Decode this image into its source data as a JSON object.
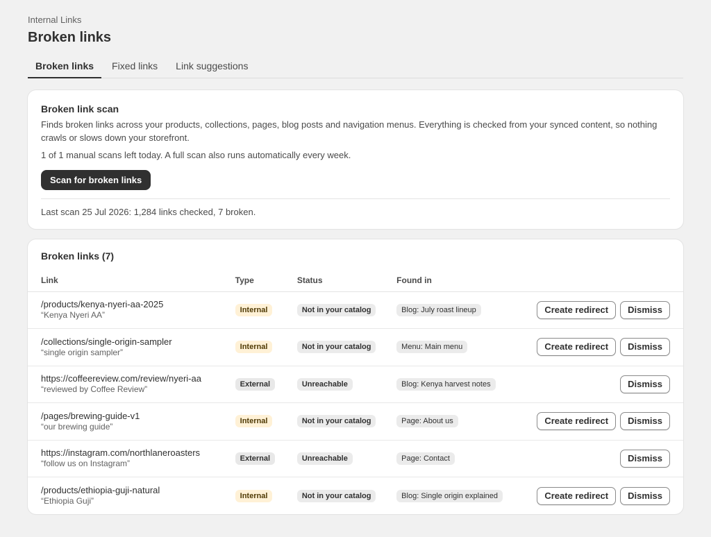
{
  "header": {
    "breadcrumb": "Internal Links",
    "title": "Broken links"
  },
  "tabs": [
    {
      "label": "Broken links",
      "active": true
    },
    {
      "label": "Fixed links",
      "active": false
    },
    {
      "label": "Link suggestions",
      "active": false
    }
  ],
  "scan": {
    "title": "Broken link scan",
    "description": "Finds broken links across your products, collections, pages, blog posts and navigation menus. Everything is checked from your synced content, so nothing crawls or slows down your storefront.",
    "quota": "1 of 1 manual scans left today. A full scan also runs automatically every week.",
    "button_label": "Scan for broken links",
    "last_scan": "Last scan 25 Jul 2026: 1,284 links checked, 7 broken."
  },
  "links_table": {
    "title": "Broken links (7)",
    "columns": [
      "Link",
      "Type",
      "Status",
      "Found in"
    ],
    "create_redirect_label": "Create redirect",
    "dismiss_label": "Dismiss",
    "rows": [
      {
        "url": "/products/kenya-nyeri-aa-2025",
        "anchor": "“Kenya Nyeri AA”",
        "type": "Internal",
        "status": "Not in your catalog",
        "found_in": "Blog: July roast lineup",
        "can_redirect": true
      },
      {
        "url": "/collections/single-origin-sampler",
        "anchor": "“single origin sampler”",
        "type": "Internal",
        "status": "Not in your catalog",
        "found_in": "Menu: Main menu",
        "can_redirect": true
      },
      {
        "url": "https://coffeereview.com/review/nyeri-aa",
        "anchor": "“reviewed by Coffee Review”",
        "type": "External",
        "status": "Unreachable",
        "found_in": "Blog: Kenya harvest notes",
        "can_redirect": false
      },
      {
        "url": "/pages/brewing-guide-v1",
        "anchor": "“our brewing guide”",
        "type": "Internal",
        "status": "Not in your catalog",
        "found_in": "Page: About us",
        "can_redirect": true
      },
      {
        "url": "https://instagram.com/northlaneroasters",
        "anchor": "“follow us on Instagram”",
        "type": "External",
        "status": "Unreachable",
        "found_in": "Page: Contact",
        "can_redirect": false
      },
      {
        "url": "/products/ethiopia-guji-natural",
        "anchor": "“Ethiopia Guji”",
        "type": "Internal",
        "status": "Not in your catalog",
        "found_in": "Blog: Single origin explained",
        "can_redirect": true
      }
    ]
  },
  "colors": {
    "background": "#f1f1f1",
    "primary_button": "#303030",
    "internal_badge": "#fff1d6",
    "neutral_badge": "#ebebeb"
  }
}
